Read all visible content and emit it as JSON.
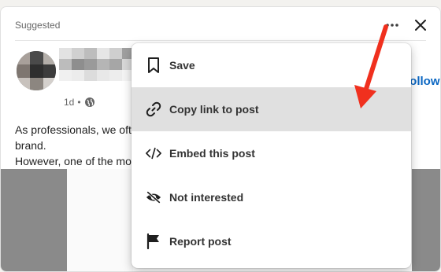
{
  "post": {
    "suggested_label": "Suggested",
    "meta_time": "1d",
    "meta_sep": "•",
    "follow_label": "Follow",
    "text_lines": [
      "As professionals, we ofte",
      "brand.",
      "However, one of the mo"
    ]
  },
  "menu": {
    "items": [
      {
        "label": "Save",
        "icon": "bookmark-icon"
      },
      {
        "label": "Copy link to post",
        "icon": "link-icon",
        "active": true
      },
      {
        "label": "Embed this post",
        "icon": "code-icon"
      },
      {
        "label": "Not interested",
        "icon": "eye-slash-icon"
      },
      {
        "label": "Report post",
        "icon": "flag-icon"
      }
    ]
  },
  "colors": {
    "accent": "#0a66c2",
    "annotation_arrow": "#f0301e",
    "active_item_bg": "#e0e0e0"
  }
}
